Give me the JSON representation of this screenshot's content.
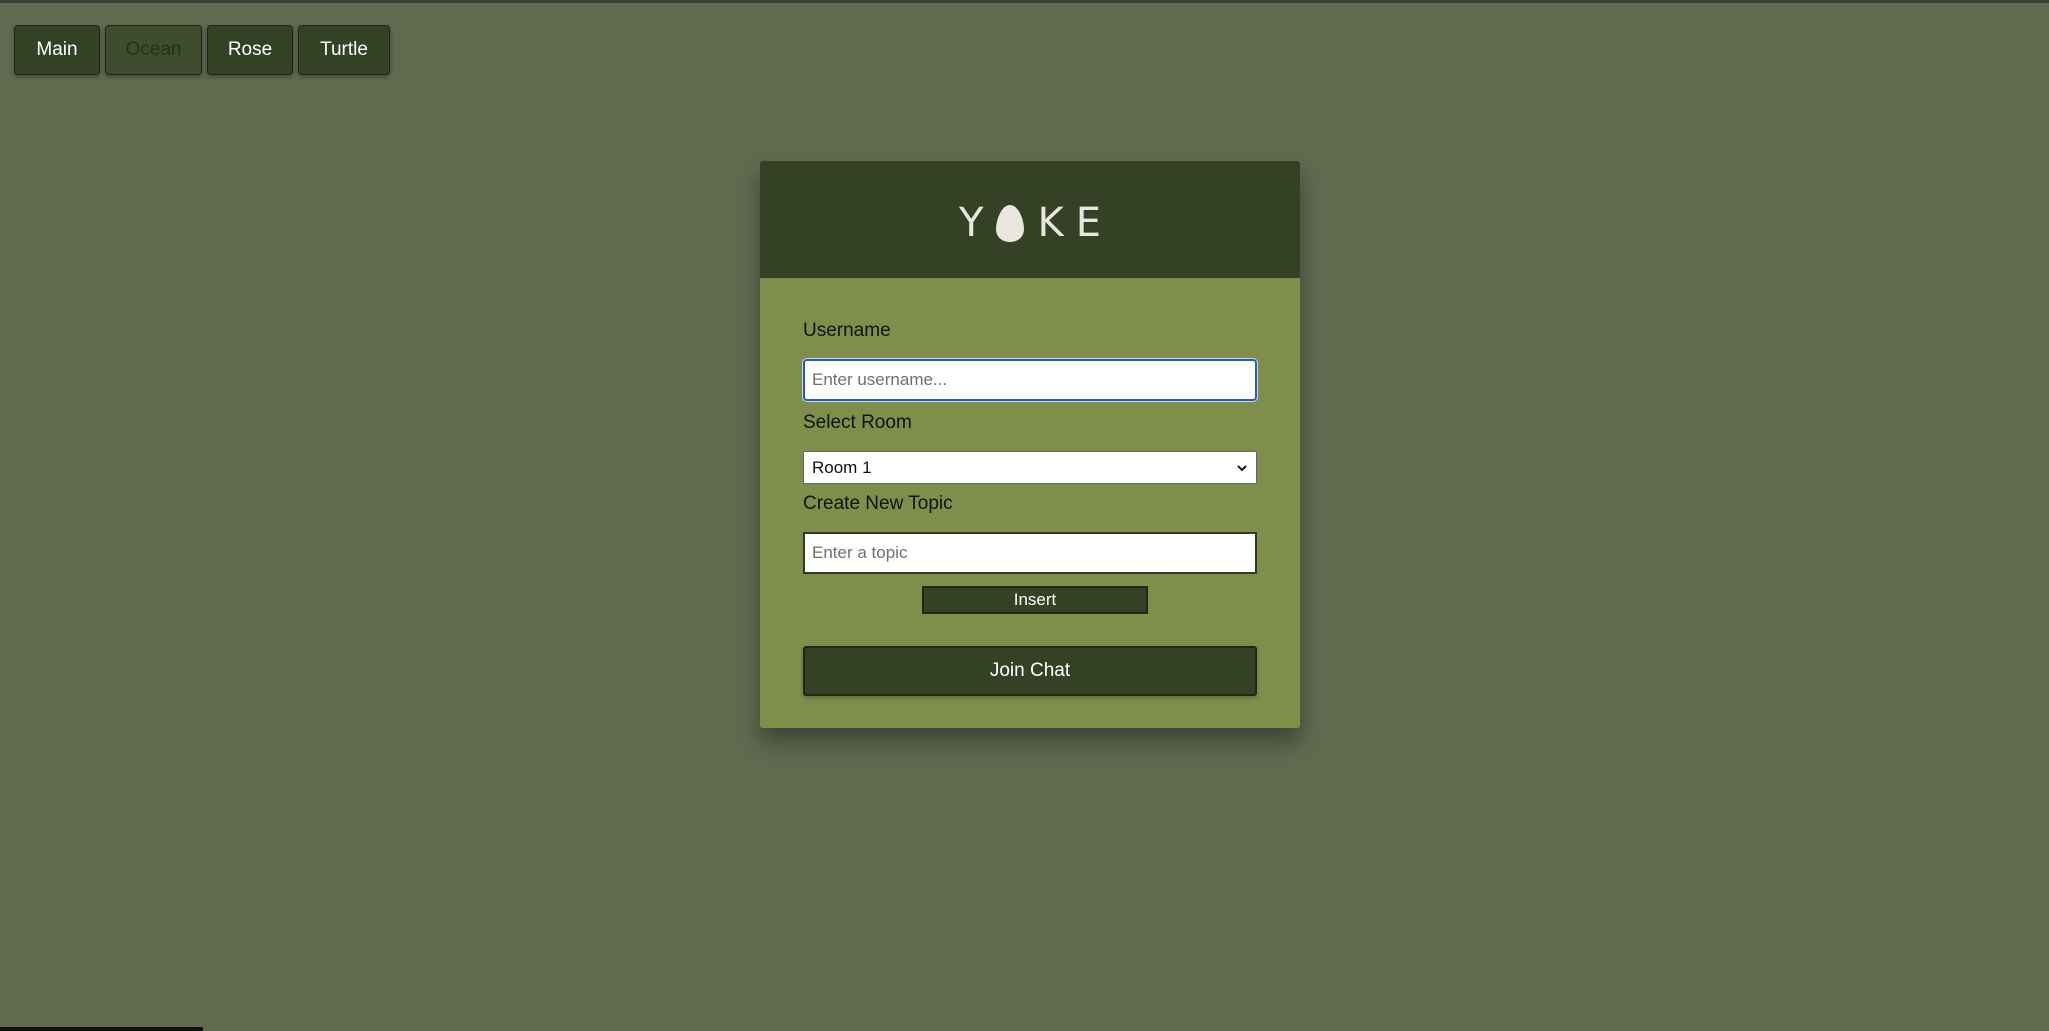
{
  "theme_switcher": {
    "buttons": [
      {
        "label": "Main"
      },
      {
        "label": "Ocean"
      },
      {
        "label": "Rose"
      },
      {
        "label": "Turtle"
      }
    ]
  },
  "logo": {
    "letters": [
      "Y",
      "K",
      "E"
    ],
    "egg_icon": "egg-icon"
  },
  "form": {
    "username_label": "Username",
    "username_placeholder": "Enter username...",
    "room_label": "Select Room",
    "room_selected": "Room 1",
    "topic_label": "Create New Topic",
    "topic_placeholder": "Enter a topic",
    "insert_label": "Insert",
    "join_label": "Join Chat"
  },
  "colors": {
    "background": "#61694f",
    "header": "#344125",
    "card": "#7f8f4b",
    "button": "#334125"
  }
}
